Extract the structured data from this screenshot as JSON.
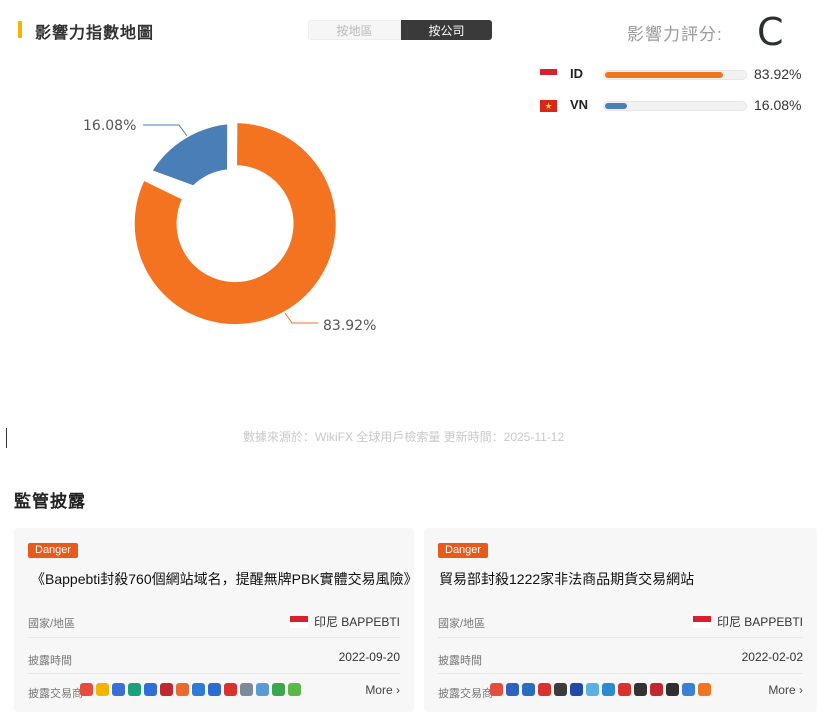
{
  "header": {
    "title": "影響力指數地圖",
    "toggle": {
      "by_region": "按地區",
      "by_company": "按公司",
      "active": "by_company"
    },
    "score_label": "影響力評分:",
    "score_value": "C"
  },
  "legend": [
    {
      "code": "ID",
      "percent": "83.92%",
      "share": 0.8392,
      "flag": "indonesia-flag-icon",
      "color": "#f07520"
    },
    {
      "code": "VN",
      "percent": "16.08%",
      "share": 0.1608,
      "flag": "vietnam-flag-icon",
      "color": "#4a7fb8"
    }
  ],
  "donut": {
    "label_small": "16.08%",
    "label_large": "83.92%"
  },
  "source_note": "數據來源於：WikiFX 全球用戶檢索量 更新時間：2025-11-12",
  "regulatory": {
    "title": "監管披露",
    "cards": [
      {
        "tag": "Danger",
        "headline": "《Bappebti封殺760個網站域名，提醒無牌PBK實體交易風險》",
        "region_label": "國家/地區",
        "region_value": "印尼 BAPPEBTI",
        "date_label": "披露時間",
        "date_value": "2022-09-20",
        "brokers_label": "披露交易商",
        "more": "More",
        "icons": [
          "#e84c3d",
          "#f3b400",
          "#3b6fd8",
          "#1aa07a",
          "#2f6fd6",
          "#c0282d",
          "#e86a2c",
          "#2d7cd6",
          "#2c6ed0",
          "#d9322e",
          "#7d8a99",
          "#5b9bd5",
          "#3aa84a",
          "#58b947"
        ]
      },
      {
        "tag": "Danger",
        "headline": "貿易部封殺1222家非法商品期貨交易網站",
        "region_label": "國家/地區",
        "region_value": "印尼 BAPPEBTI",
        "date_label": "披露時間",
        "date_value": "2022-02-02",
        "brokers_label": "披露交易商",
        "more": "More",
        "icons": [
          "#e84c3d",
          "#2f5fbf",
          "#2a6fbf",
          "#d9322e",
          "#3b3b3b",
          "#1f4aa8",
          "#5ab0e0",
          "#2c8ad0",
          "#d9322e",
          "#333333",
          "#c0282d",
          "#2f2f2f",
          "#3b82d6",
          "#f07520"
        ]
      }
    ]
  }
}
